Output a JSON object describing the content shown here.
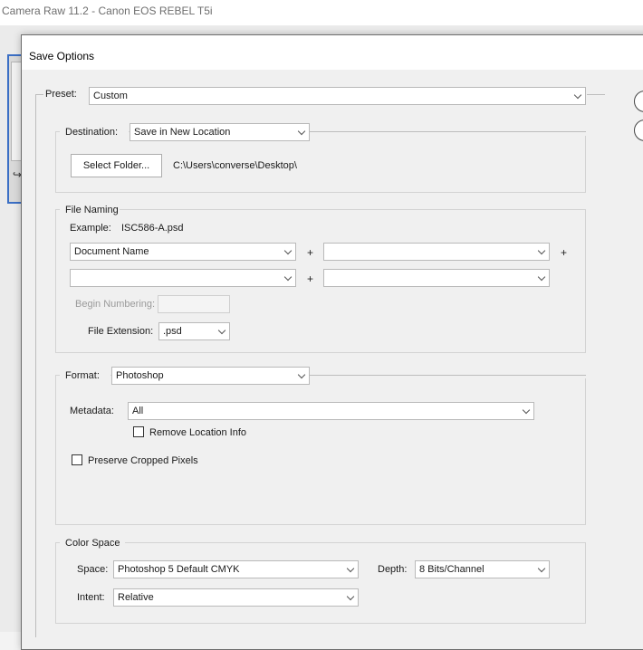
{
  "window": {
    "title": "Camera Raw 11.2  -  Canon EOS REBEL T5i"
  },
  "dialog": {
    "title": "Save Options"
  },
  "preset": {
    "label": "Preset:",
    "value": "Custom"
  },
  "destination": {
    "label": "Destination:",
    "value": "Save in New Location",
    "select_folder_label": "Select Folder...",
    "path": "C:\\Users\\converse\\Desktop\\"
  },
  "file_naming": {
    "title": "File Naming",
    "example_label": "Example:",
    "example_value": "ISC586-A.psd",
    "field1": "Document Name",
    "field2": "",
    "field3": "",
    "field4": "",
    "plus": "+",
    "begin_numbering_label": "Begin Numbering:",
    "begin_numbering_value": "",
    "extension_label": "File Extension:",
    "extension_value": ".psd"
  },
  "format": {
    "label": "Format:",
    "value": "Photoshop",
    "metadata_label": "Metadata:",
    "metadata_value": "All",
    "remove_location_label": "Remove Location Info",
    "remove_location_checked": false,
    "preserve_cropped_label": "Preserve Cropped Pixels",
    "preserve_cropped_checked": false
  },
  "color_space": {
    "title": "Color Space",
    "space_label": "Space:",
    "space_value": "Photoshop 5 Default CMYK",
    "depth_label": "Depth:",
    "depth_value": "8 Bits/Channel",
    "intent_label": "Intent:",
    "intent_value": "Relative"
  }
}
